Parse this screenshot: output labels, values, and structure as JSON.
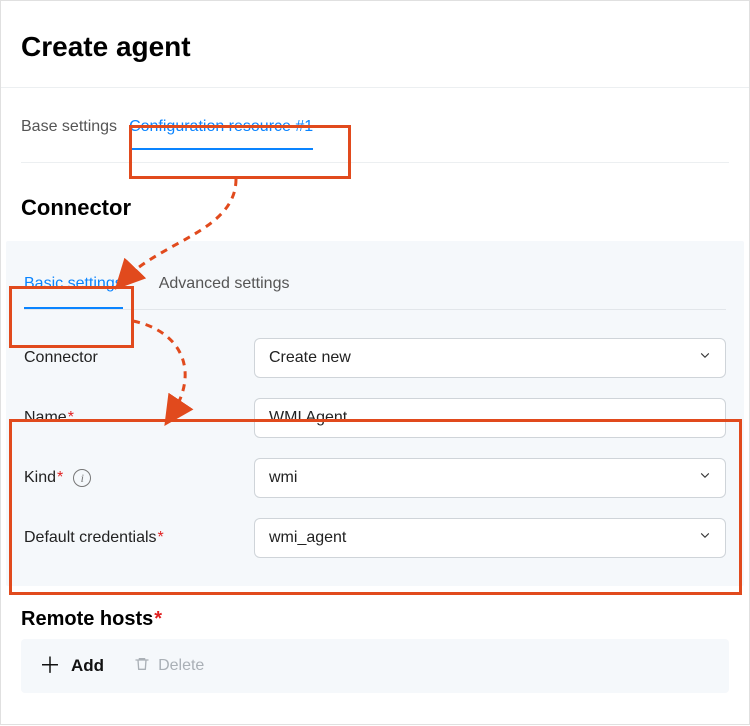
{
  "page": {
    "title": "Create agent"
  },
  "outerTabs": {
    "base": "Base settings",
    "conf": "Configuration resource #1"
  },
  "section": {
    "connector": "Connector"
  },
  "innerTabs": {
    "basic": "Basic settings",
    "advanced": "Advanced settings"
  },
  "form": {
    "connector_label": "Connector",
    "connector_value": "Create new",
    "name_label": "Name",
    "name_value": "WMI Agent",
    "kind_label": "Kind",
    "kind_value": "wmi",
    "cred_label": "Default credentials",
    "cred_value": "wmi_agent"
  },
  "remote": {
    "title": "Remote hosts",
    "add": "Add",
    "delete": "Delete"
  }
}
